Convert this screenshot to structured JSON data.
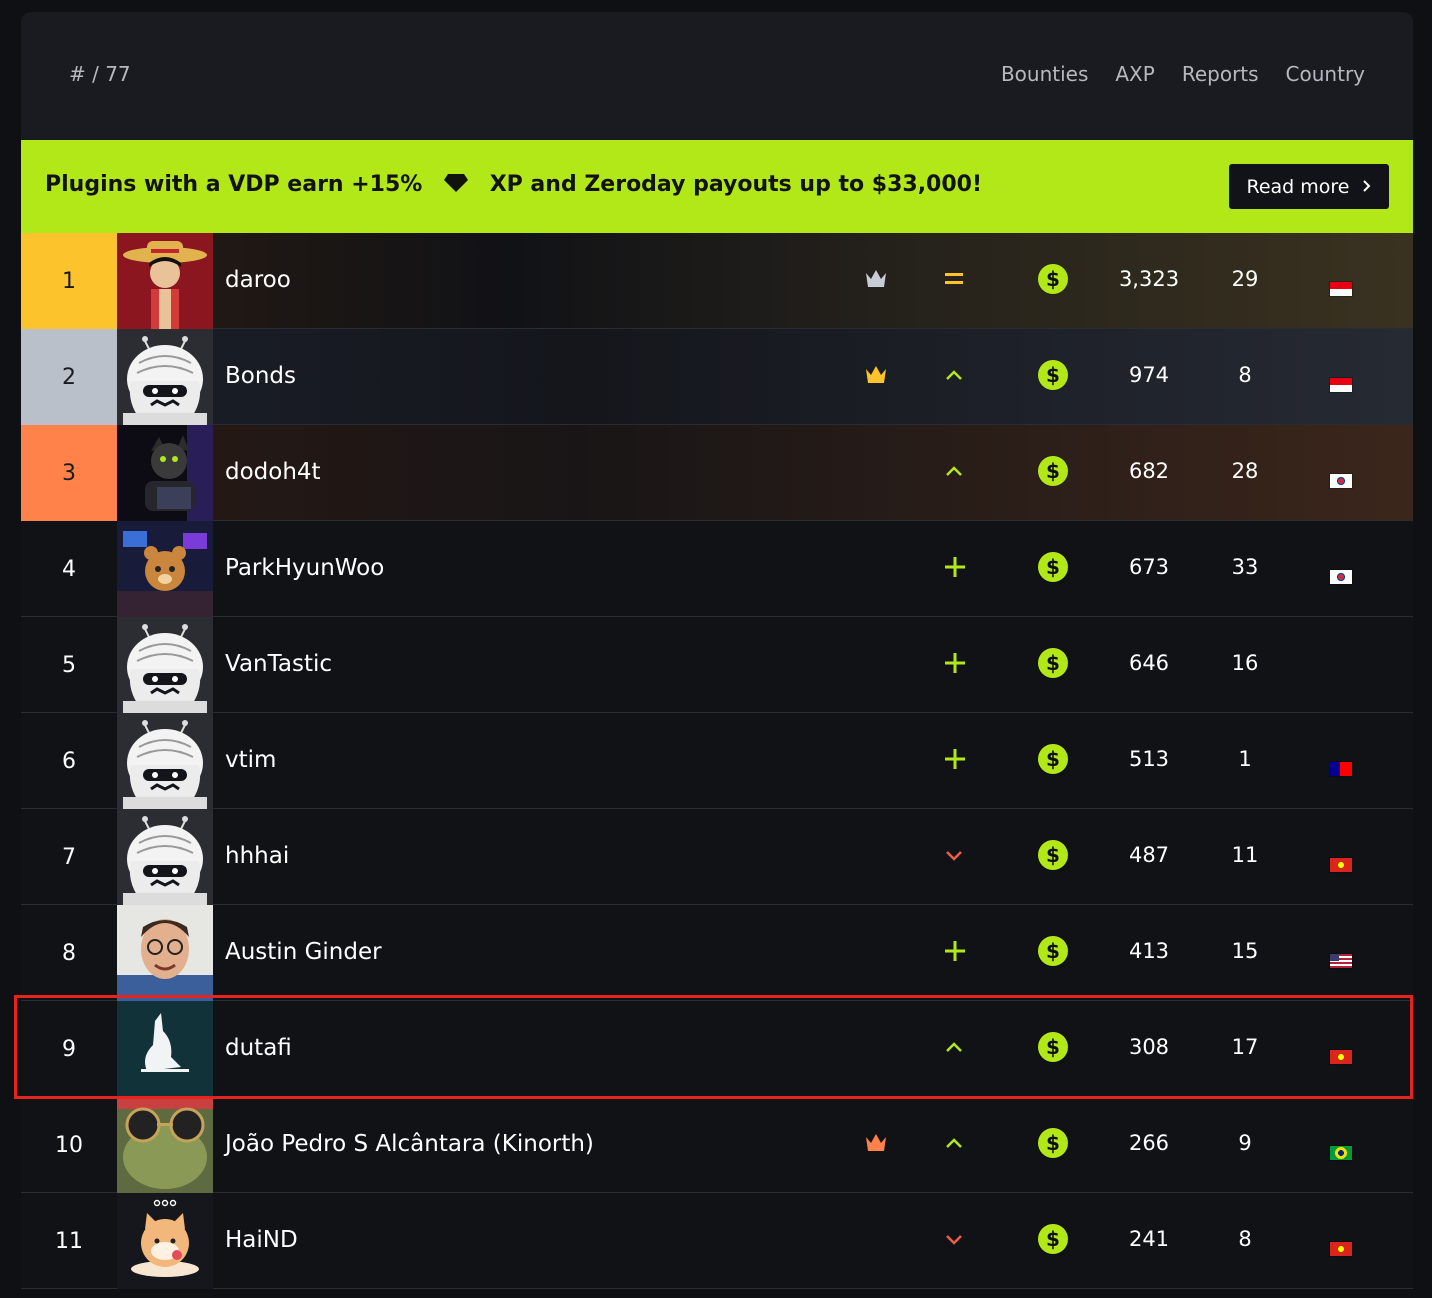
{
  "header": {
    "rank_label": "# / 77",
    "tabs": [
      "Bounties",
      "AXP",
      "Reports",
      "Country"
    ]
  },
  "banner": {
    "text_left": "Plugins with a VDP earn +15%",
    "text_right": "XP and Zeroday payouts up to $33,000!",
    "button_label": "Read more"
  },
  "colors": {
    "accent": "#b3e818",
    "rank1": "#fcc32c",
    "rank2": "#b9c0c9",
    "rank3": "#ff824b",
    "trend_down": "#ec5e48",
    "highlight": "#e52420"
  },
  "rows": [
    {
      "rank": "1",
      "name": "daroo",
      "crown": "silver-crown-icon",
      "trend": "equal-icon",
      "points": "3,323",
      "reports": "29",
      "country": "indonesia-flag-icon"
    },
    {
      "rank": "2",
      "name": "Bonds",
      "crown": "gold-crown-icon",
      "trend": "chevron-up-icon",
      "points": "974",
      "reports": "8",
      "country": "indonesia-flag-icon"
    },
    {
      "rank": "3",
      "name": "dodoh4t",
      "crown": "",
      "trend": "chevron-up-icon",
      "points": "682",
      "reports": "28",
      "country": "south-korea-flag-icon"
    },
    {
      "rank": "4",
      "name": "ParkHyunWoo",
      "crown": "",
      "trend": "plus-icon",
      "points": "673",
      "reports": "33",
      "country": "south-korea-flag-icon"
    },
    {
      "rank": "5",
      "name": "VanTastic",
      "crown": "",
      "trend": "plus-icon",
      "points": "646",
      "reports": "16",
      "country": ""
    },
    {
      "rank": "6",
      "name": "vtim",
      "crown": "",
      "trend": "plus-icon",
      "points": "513",
      "reports": "1",
      "country": "taiwan-flag-icon"
    },
    {
      "rank": "7",
      "name": "hhhai",
      "crown": "",
      "trend": "chevron-down-icon",
      "points": "487",
      "reports": "11",
      "country": "vietnam-flag-icon"
    },
    {
      "rank": "8",
      "name": "Austin Ginder",
      "crown": "",
      "trend": "plus-icon",
      "points": "413",
      "reports": "15",
      "country": "usa-flag-icon"
    },
    {
      "rank": "9",
      "name": "dutafi",
      "crown": "",
      "trend": "chevron-up-icon",
      "points": "308",
      "reports": "17",
      "country": "vietnam-flag-icon",
      "highlighted": true
    },
    {
      "rank": "10",
      "name": "João Pedro S Alcântara (Kinorth)",
      "crown": "bronze-crown-icon",
      "trend": "chevron-up-icon",
      "points": "266",
      "reports": "9",
      "country": "brazil-flag-icon"
    },
    {
      "rank": "11",
      "name": "HaiND",
      "crown": "",
      "trend": "chevron-down-icon",
      "points": "241",
      "reports": "8",
      "country": "vietnam-flag-icon"
    }
  ]
}
